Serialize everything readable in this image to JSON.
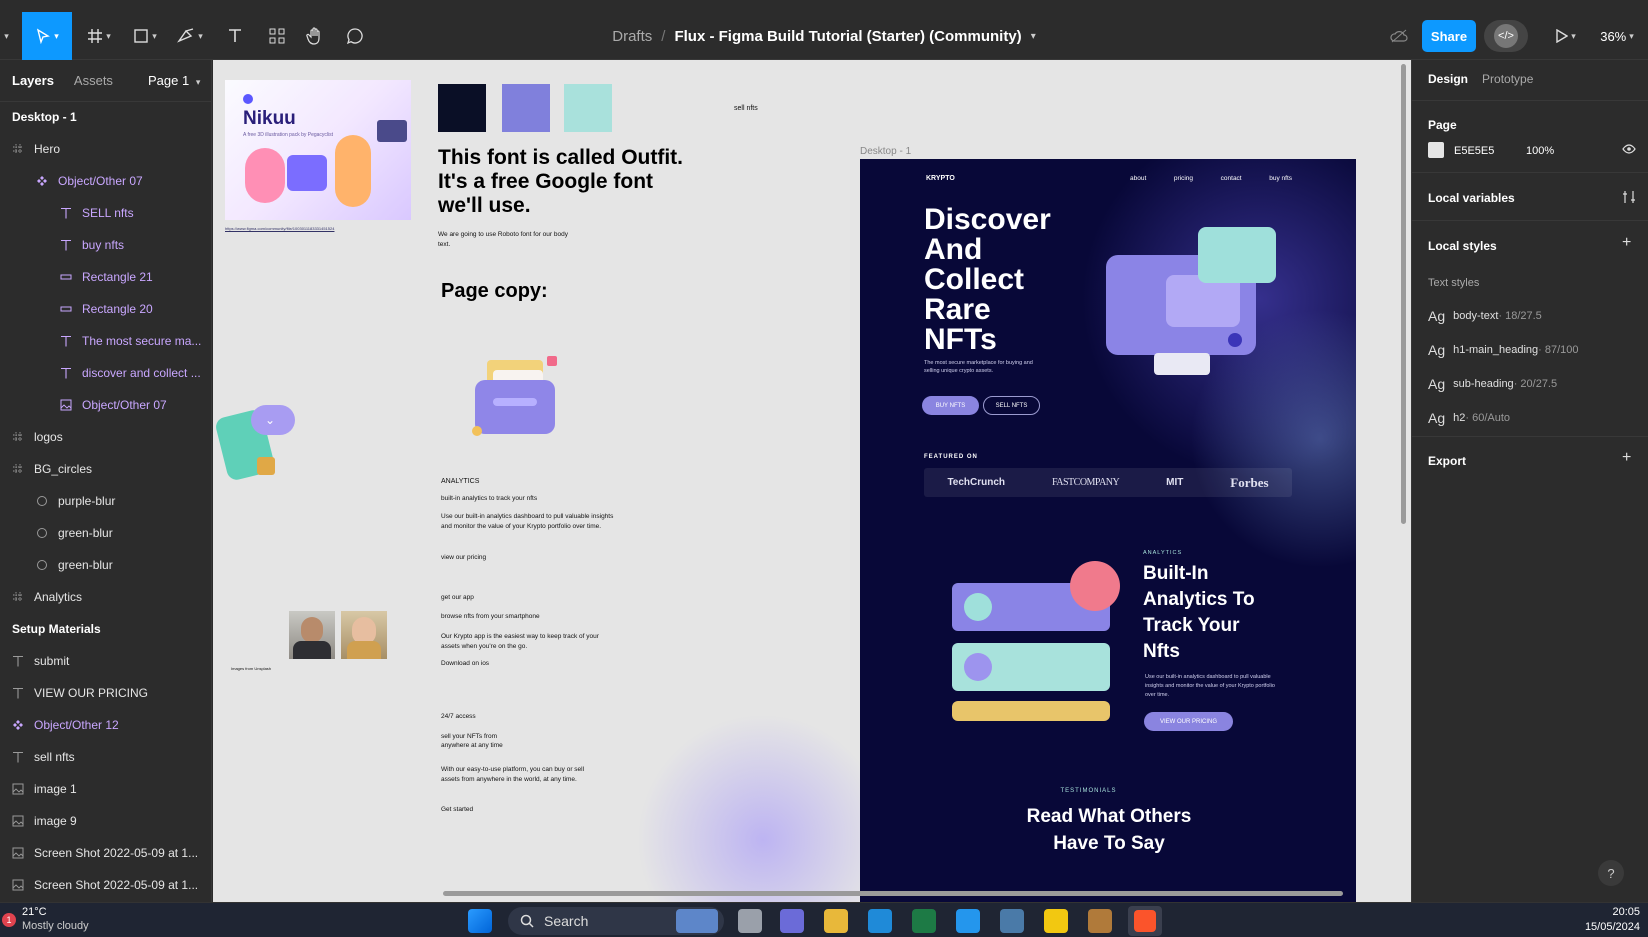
{
  "toolbar": {
    "breadcrumb_drafts": "Drafts",
    "breadcrumb_sep": "/",
    "file_title": "Flux - Figma Build Tutorial (Starter) (Community)",
    "share_label": "Share",
    "zoom": "36%"
  },
  "left_panel": {
    "tabs": {
      "layers": "Layers",
      "assets": "Assets",
      "page": "Page 1"
    },
    "frame_name": "Desktop - 1",
    "layers": [
      {
        "label": "Hero",
        "icon": "frame-grid-icon",
        "purple": false
      },
      {
        "label": "Object/Other 07",
        "icon": "component-icon",
        "purple": true
      },
      {
        "label": "SELL nfts",
        "icon": "text-icon",
        "purple": true
      },
      {
        "label": "buy nfts",
        "icon": "text-icon",
        "purple": true
      },
      {
        "label": "Rectangle 21",
        "icon": "rectangle-icon",
        "purple": true
      },
      {
        "label": "Rectangle 20",
        "icon": "rectangle-icon",
        "purple": true
      },
      {
        "label": "The most secure ma...",
        "icon": "text-icon",
        "purple": true
      },
      {
        "label": "discover and collect ...",
        "icon": "text-icon",
        "purple": true
      },
      {
        "label": "Object/Other 07",
        "icon": "image-icon",
        "purple": true
      },
      {
        "label": "logos",
        "icon": "frame-grid-icon",
        "purple": false
      },
      {
        "label": "BG_circles",
        "icon": "frame-grid-icon",
        "purple": false
      },
      {
        "label": "purple-blur",
        "icon": "ellipse-icon",
        "purple": false
      },
      {
        "label": "green-blur",
        "icon": "ellipse-icon",
        "purple": false
      },
      {
        "label": "green-blur",
        "icon": "ellipse-icon",
        "purple": false
      },
      {
        "label": "Analytics",
        "icon": "frame-grid-icon",
        "purple": false
      }
    ],
    "section2": "Setup Materials",
    "layers2": [
      {
        "label": "submit",
        "icon": "text-icon",
        "purple": false
      },
      {
        "label": "VIEW OUR PRICING",
        "icon": "text-icon",
        "purple": false
      },
      {
        "label": "Object/Other 12",
        "icon": "component-icon",
        "purple": true
      },
      {
        "label": "sell nfts",
        "icon": "text-icon",
        "purple": false
      },
      {
        "label": "image 1",
        "icon": "image-icon",
        "purple": false
      },
      {
        "label": "image 9",
        "icon": "image-icon",
        "purple": false
      },
      {
        "label": "Screen Shot 2022-05-09 at 1...",
        "icon": "image-icon",
        "purple": false
      },
      {
        "label": "Screen Shot 2022-05-09 at 1...",
        "icon": "image-icon",
        "purple": false
      }
    ]
  },
  "right_panel": {
    "tabs": {
      "design": "Design",
      "prototype": "Prototype"
    },
    "page_label": "Page",
    "page_color": "E5E5E5",
    "page_opacity": "100%",
    "local_variables": "Local variables",
    "local_styles": "Local styles",
    "text_styles": "Text styles",
    "styles": [
      {
        "name": "body-text",
        "size": " · 18/27.5"
      },
      {
        "name": "h1-main_heading",
        "size": " · 87/100"
      },
      {
        "name": "sub-heading",
        "size": " · 20/27.5"
      },
      {
        "name": "h2",
        "size": " · 60/Auto"
      }
    ],
    "export": "Export",
    "ag": "Ag",
    "help": "?"
  },
  "canvas": {
    "nikuu_title": "Nikuu",
    "nikuu_sub": "A free 3D illustration pack by Pegacyclist",
    "figma_link": "https://www.figma.com/community/file/1003011183331451524",
    "font_heading": "This font is called Outfit. It's a free Google font we'll use.",
    "roboto_note": "We are going to use Roboto font for our body text.",
    "sell_nfts": "sell nfts",
    "page_copy": "Page copy:",
    "analytics": "ANALYTICS",
    "analytics_sub": "built-in analytics to track your nfts",
    "analytics_body": "Use our built-in analytics dashboard to pull valuable insights and monitor the value of your Krypto portfolio over time.",
    "view_pricing": "view our pricing",
    "get_app": "get our app",
    "browse": "browse nfts from your smartphone",
    "app_body": "Our Krypto app is the easiest way to keep track of your assets when you're on the go.",
    "download": "Download on ios",
    "access": "24/7 access",
    "sell_anywhere": "sell your NFTs from anywhere at any time",
    "platform_body": "With our easy-to-use platform, you can buy or sell assets from anywhere in the world, at any time.",
    "get_started": "Get started",
    "images_from": "Images from Unsplash",
    "frame_label": "Desktop - 1",
    "swatches": [
      "#0a0f26",
      "#8080dc",
      "#a9e1dc"
    ]
  },
  "site": {
    "logo": "KRYPTO",
    "nav": [
      "about",
      "pricing",
      "contact",
      "buy nfts"
    ],
    "hero_title": "Discover And Collect Rare NFTs",
    "hero_sub": "The most secure marketplace for buying and selling unique crypto assets.",
    "btn_buy": "BUY NFTS",
    "btn_sell": "SELL NFTS",
    "featured": "FEATURED ON",
    "logos": [
      "TechCrunch",
      "FASTCOMPANY",
      "MIT",
      "Forbes"
    ],
    "analytics_label": "ANALYTICS",
    "analytics_title": "Built-In Analytics To Track Your Nfts",
    "analytics_body": "Use our built-in analytics dashboard to pull valuable insights and monitor the value of your Krypto portfolio over time.",
    "view_pricing": "VIEW OUR PRICING",
    "testimonials": "TESTIMONIALS",
    "testimonials_title": "Read What Others Have To Say"
  },
  "taskbar": {
    "weather_temp": "21°C",
    "weather_desc": "Mostly cloudy",
    "search": "Search",
    "time": "20:05",
    "date": "15/05/2024",
    "badge": "1"
  }
}
